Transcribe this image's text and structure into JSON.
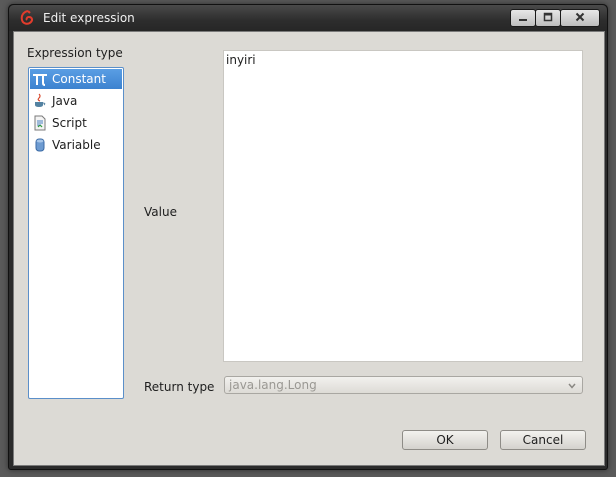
{
  "window": {
    "title": "Edit expression",
    "app_icon": "jaspersoft-swirl-icon",
    "controls": [
      "minimize-icon",
      "maximize-icon",
      "close-icon"
    ]
  },
  "expression_type": {
    "label": "Expression type",
    "selected": "Constant",
    "items": [
      {
        "label": "Constant",
        "icon": "pi-icon"
      },
      {
        "label": "Java",
        "icon": "java-cup-icon"
      },
      {
        "label": "Script",
        "icon": "script-icon"
      },
      {
        "label": "Variable",
        "icon": "variable-cylinder-icon"
      }
    ]
  },
  "value": {
    "label": "Value",
    "text": "inyiri"
  },
  "return_type": {
    "label": "Return type",
    "value": "java.lang.Long"
  },
  "buttons": {
    "ok": "OK",
    "cancel": "Cancel"
  },
  "colors": {
    "selection": "#3c82cf",
    "list_border": "#5b8fc9",
    "dialog_bg": "#dcdad5",
    "title_bar": "#2d2d2d"
  }
}
